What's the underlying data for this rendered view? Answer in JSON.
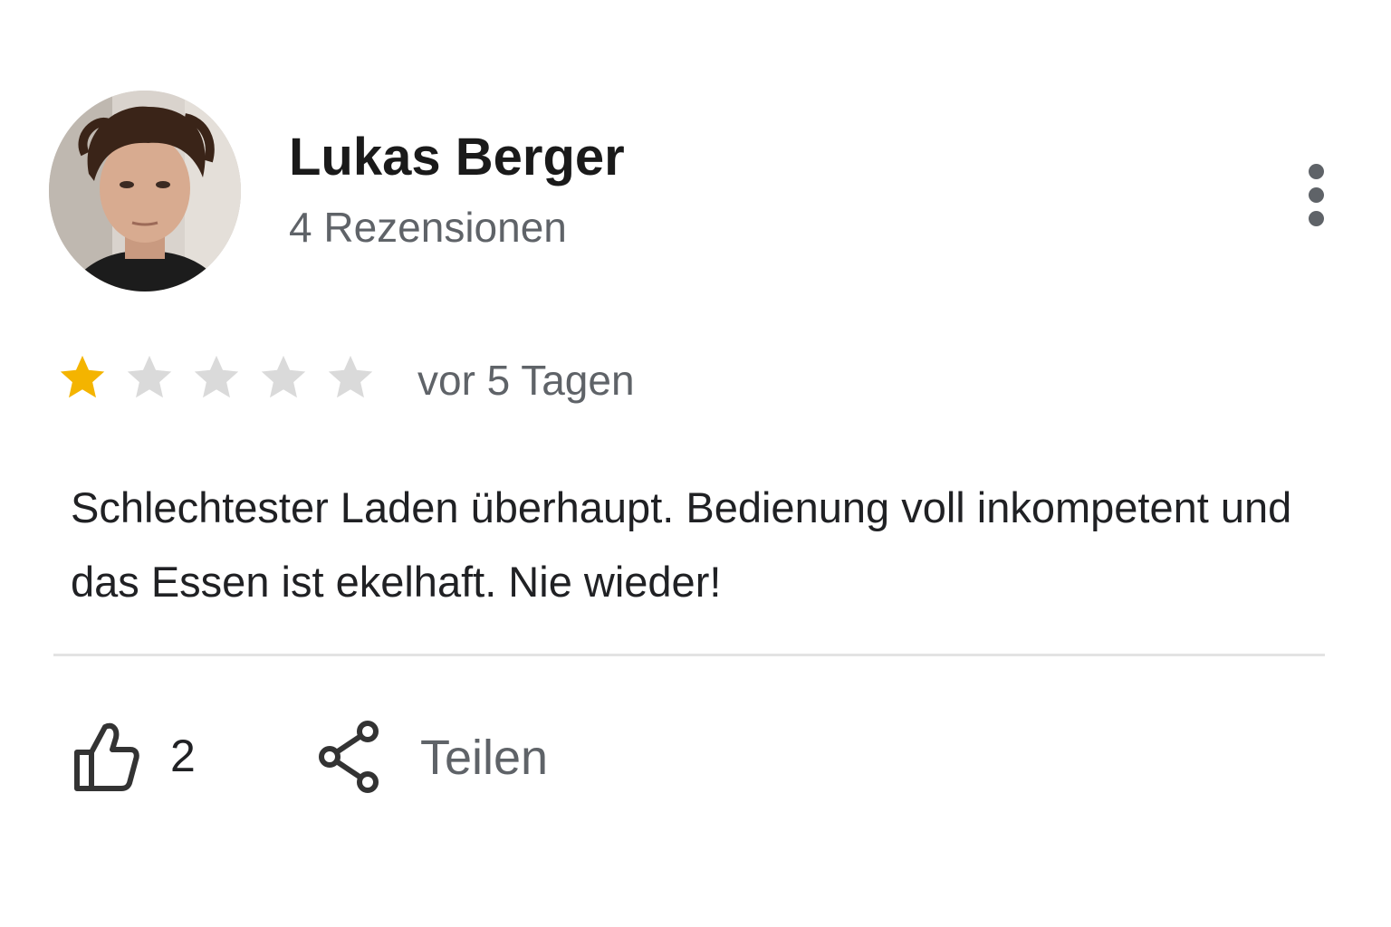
{
  "review": {
    "author": {
      "name": "Lukas Berger",
      "review_count": "4 Rezensionen"
    },
    "rating": {
      "value": 1,
      "max": 5,
      "filled_color": "#F4B400",
      "empty_color": "#DADADA"
    },
    "date": "vor 5 Tagen",
    "text": "Schlechtester Laden überhaupt. Bedienung voll inkompetent und das Essen ist ekelhaft. Nie wieder!",
    "actions": {
      "like_count": "2",
      "share_label": "Teilen"
    }
  },
  "icons": {
    "more": "more-vert-icon",
    "like": "thumb-up-icon",
    "share": "share-icon",
    "star": "star-icon"
  }
}
